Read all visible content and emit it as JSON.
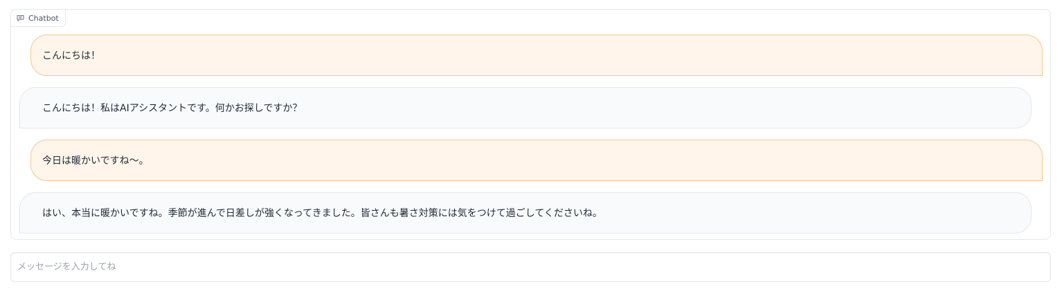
{
  "chatbot": {
    "label": "Chatbot",
    "messages": [
      {
        "role": "user",
        "text": "こんにちは！"
      },
      {
        "role": "bot",
        "text": "こんにちは！私はAIアシスタントです。何かお探しですか？"
      },
      {
        "role": "user",
        "text": "今日は暖かいですね〜。"
      },
      {
        "role": "bot",
        "text": "はい、本当に暖かいですね。季節が進んで日差しが強くなってきました。皆さんも暑さ対策には気をつけて過ごしてくださいね。"
      }
    ]
  },
  "input": {
    "placeholder": "メッセージを入力してね",
    "value": ""
  },
  "colors": {
    "user_bubble_bg": "#fff5ea",
    "user_bubble_border": "#f3c98b",
    "bot_bubble_bg": "#f9fafb",
    "bot_bubble_border": "#e5e7eb"
  },
  "icons": {
    "label_icon": "chat-icon"
  }
}
